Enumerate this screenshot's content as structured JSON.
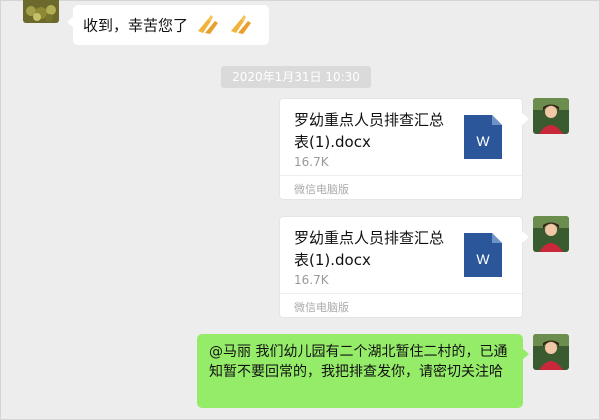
{
  "messages": {
    "incoming": {
      "text": "收到，幸苦您了",
      "emoji_icons": [
        "praying-hands-icon",
        "praying-hands-icon"
      ]
    },
    "timestamp": "2020年1月31日 10:30",
    "file_1": {
      "name": "罗幼重点人员排查汇总表(1).docx",
      "size": "16.7K",
      "source": "微信电脑版",
      "icon": "word-doc-icon",
      "icon_letter": "W"
    },
    "file_2": {
      "name": "罗幼重点人员排查汇总表(1).docx",
      "size": "16.7K",
      "source": "微信电脑版",
      "icon": "word-doc-icon",
      "icon_letter": "W"
    },
    "outgoing": {
      "text": "@马丽 我们幼儿园有二个湖北暂住二村的，已通知暂不要回常的，我把排查发你，请密切关注哈"
    }
  },
  "colors": {
    "background": "#ededed",
    "outgoing_bubble": "#95ec69",
    "word_blue": "#2b579a"
  }
}
